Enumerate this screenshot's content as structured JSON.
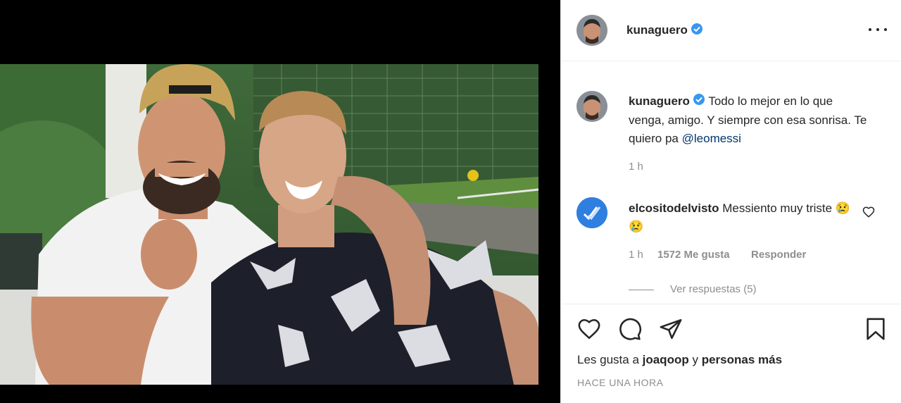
{
  "post": {
    "username": "kunaguero",
    "caption_user": "kunaguero",
    "caption_text": "Todo lo mejor en lo que venga, amigo. Y siempre con esa sonrisa. Te quiero pa ",
    "caption_mention": "@leomessi",
    "caption_time": "1 h"
  },
  "comment": {
    "username": "elcositodelvisto",
    "text": "Messiento muy triste 😢😢",
    "time": "1 h",
    "likes": "1572 Me gusta",
    "reply": "Responder",
    "view_replies": "Ver respuestas (5)"
  },
  "footer": {
    "likes_prefix": "Les gusta a ",
    "likes_user": "joaqoop",
    "likes_middle": " y ",
    "likes_suffix": "personas más",
    "timestamp": "HACE UNA HORA"
  },
  "colors": {
    "verified": "#3897f0",
    "mention": "#00376b",
    "muted": "#8e8e8e"
  },
  "icons": [
    "verified-icon",
    "more-options-icon",
    "heart-icon",
    "comment-icon",
    "share-icon",
    "bookmark-icon",
    "heart-small-icon"
  ]
}
